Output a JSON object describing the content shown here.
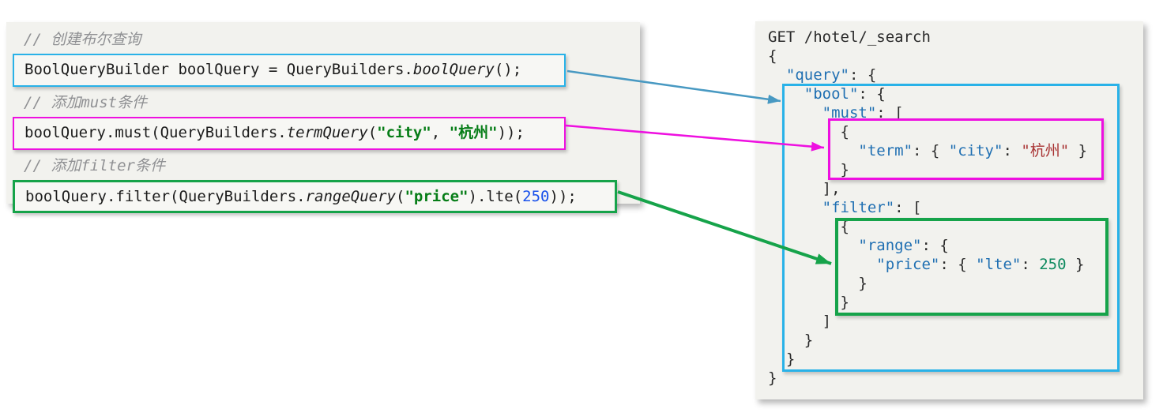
{
  "colors": {
    "panel_bg": "#f2f2ee",
    "box_blue": "#29b2e8",
    "box_magenta": "#ee10e0",
    "box_green": "#16a34a",
    "arrow_blue": "#4899c2",
    "java_comment_gray": "#8f9093",
    "java_string_green": "#067d17",
    "java_number_blue": "#1750eb",
    "json_key_blue": "#1f6fb2",
    "json_string_red": "#a83232",
    "json_number_green": "#0e8a5f"
  },
  "java_panel": {
    "lines": [
      {
        "type": "comment",
        "text": "// 创建布尔查询"
      },
      {
        "type": "code",
        "box": "blue",
        "segments": [
          {
            "c": "plain",
            "t": "BoolQueryBuilder boolQuery = QueryBuilders."
          },
          {
            "c": "method",
            "t": "boolQuery"
          },
          {
            "c": "plain",
            "t": "();"
          }
        ]
      },
      {
        "type": "comment",
        "text": "// 添加must条件"
      },
      {
        "type": "code",
        "box": "magenta",
        "segments": [
          {
            "c": "plain",
            "t": "boolQuery.must(QueryBuilders."
          },
          {
            "c": "method",
            "t": "termQuery"
          },
          {
            "c": "plain",
            "t": "("
          },
          {
            "c": "string",
            "t": "\"city\""
          },
          {
            "c": "plain",
            "t": ", "
          },
          {
            "c": "string",
            "t": "\"杭州\""
          },
          {
            "c": "plain",
            "t": "));"
          }
        ]
      },
      {
        "type": "comment",
        "text": "// 添加filter条件"
      },
      {
        "type": "code",
        "box": "green",
        "segments": [
          {
            "c": "plain",
            "t": "boolQuery.filter(QueryBuilders."
          },
          {
            "c": "method",
            "t": "rangeQuery"
          },
          {
            "c": "plain",
            "t": "("
          },
          {
            "c": "string",
            "t": "\"price\""
          },
          {
            "c": "plain",
            "t": ").lte("
          },
          {
            "c": "number",
            "t": "250"
          },
          {
            "c": "plain",
            "t": "));"
          }
        ]
      }
    ]
  },
  "dsl_panel": {
    "request_line": "GET /hotel/_search",
    "lines": [
      [
        {
          "c": "plain",
          "t": "GET /hotel/_search"
        }
      ],
      [
        {
          "c": "plain",
          "t": "{"
        }
      ],
      [
        {
          "c": "plain",
          "t": "  "
        },
        {
          "c": "key",
          "t": "\"query\""
        },
        {
          "c": "plain",
          "t": ": {"
        }
      ],
      [
        {
          "c": "plain",
          "t": "    "
        },
        {
          "c": "key",
          "t": "\"bool\""
        },
        {
          "c": "plain",
          "t": ": {"
        }
      ],
      [
        {
          "c": "plain",
          "t": "      "
        },
        {
          "c": "key",
          "t": "\"must\""
        },
        {
          "c": "plain",
          "t": ": ["
        }
      ],
      [
        {
          "c": "plain",
          "t": "        {"
        }
      ],
      [
        {
          "c": "plain",
          "t": "          "
        },
        {
          "c": "key",
          "t": "\"term\""
        },
        {
          "c": "plain",
          "t": ": { "
        },
        {
          "c": "key",
          "t": "\"city\""
        },
        {
          "c": "plain",
          "t": ": "
        },
        {
          "c": "str",
          "t": "\"杭州\""
        },
        {
          "c": "plain",
          "t": " }"
        }
      ],
      [
        {
          "c": "plain",
          "t": "        }"
        }
      ],
      [
        {
          "c": "plain",
          "t": "      ],"
        }
      ],
      [
        {
          "c": "plain",
          "t": "      "
        },
        {
          "c": "key",
          "t": "\"filter\""
        },
        {
          "c": "plain",
          "t": ": ["
        }
      ],
      [
        {
          "c": "plain",
          "t": "        {"
        }
      ],
      [
        {
          "c": "plain",
          "t": "          "
        },
        {
          "c": "key",
          "t": "\"range\""
        },
        {
          "c": "plain",
          "t": ": {"
        }
      ],
      [
        {
          "c": "plain",
          "t": "            "
        },
        {
          "c": "key",
          "t": "\"price\""
        },
        {
          "c": "plain",
          "t": ": { "
        },
        {
          "c": "key",
          "t": "\"lte\""
        },
        {
          "c": "plain",
          "t": ": "
        },
        {
          "c": "num",
          "t": "250"
        },
        {
          "c": "plain",
          "t": " }"
        }
      ],
      [
        {
          "c": "plain",
          "t": "          }"
        }
      ],
      [
        {
          "c": "plain",
          "t": "        }"
        }
      ],
      [
        {
          "c": "plain",
          "t": "      ]"
        }
      ],
      [
        {
          "c": "plain",
          "t": "    }"
        }
      ],
      [
        {
          "c": "plain",
          "t": "  }"
        }
      ],
      [
        {
          "c": "plain",
          "t": "}"
        }
      ]
    ]
  }
}
